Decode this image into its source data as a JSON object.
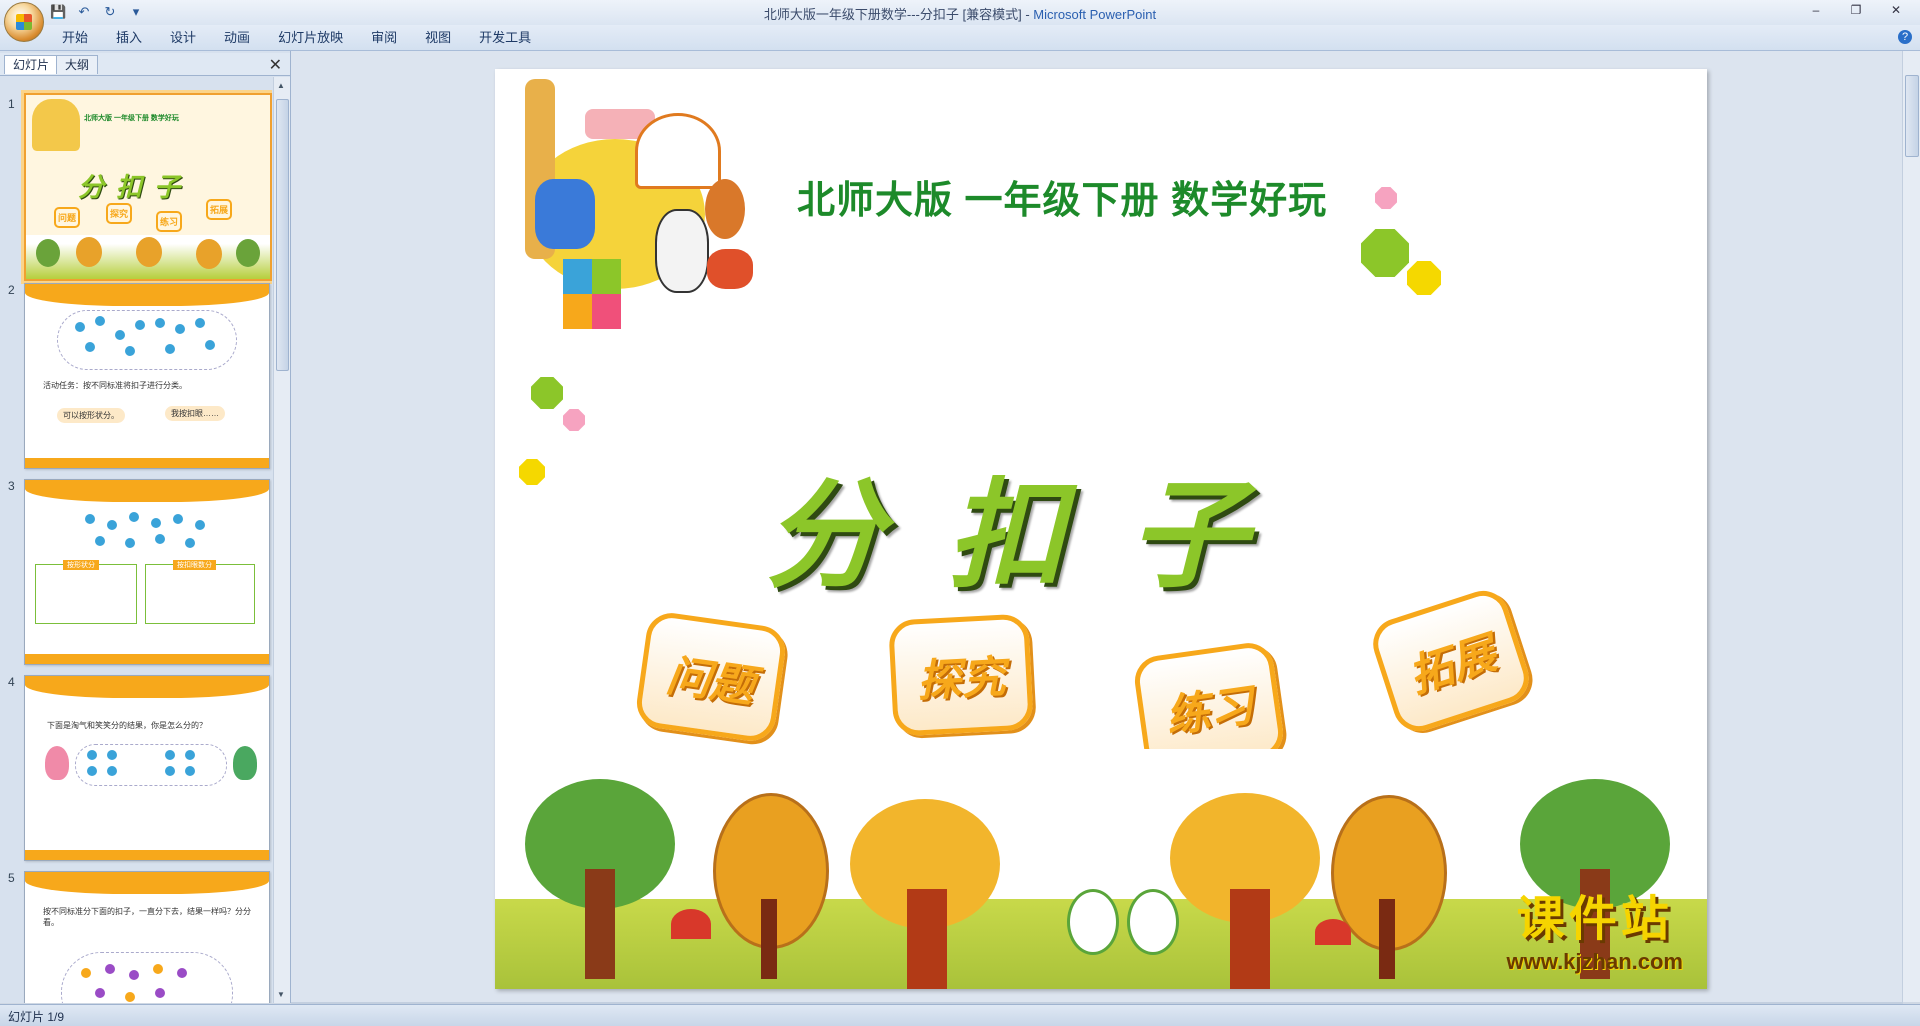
{
  "window": {
    "title": "北师大版一年级下册数学---分扣子 [兼容模式]",
    "app": "Microsoft PowerPoint",
    "separator": " - "
  },
  "qat": {
    "save": "💾",
    "undo": "↶",
    "redo": "↻",
    "more": "▾"
  },
  "ribbon_tabs": [
    "开始",
    "插入",
    "设计",
    "动画",
    "幻灯片放映",
    "审阅",
    "视图",
    "开发工具"
  ],
  "pane": {
    "tab_slides": "幻灯片",
    "tab_outline": "大纲",
    "close": "✕"
  },
  "thumbnails": [
    {
      "num": "1",
      "subtitle": "北师大版 一年级下册 数学好玩",
      "title": "分扣子",
      "btns": [
        "问题",
        "探究",
        "练习",
        "拓展"
      ]
    },
    {
      "num": "2",
      "task": "活动任务：按不同标准将扣子进行分类。",
      "bubble1": "可以按形状分。",
      "bubble2": "我按扣眼……"
    },
    {
      "num": "3",
      "label1": "按形状分",
      "label2": "按扣眼数分"
    },
    {
      "num": "4",
      "text": "下面是淘气和笑笑分的结果，你是怎么分的？"
    },
    {
      "num": "5",
      "text": "按不同标准分下面的扣子，一直分下去，结果一样吗？分分看。"
    }
  ],
  "slide": {
    "subtitle": "北师大版  一年级下册  数学好玩",
    "title": "分扣子",
    "buttons": [
      "问题",
      "探究",
      "练习",
      "拓展"
    ]
  },
  "watermark": {
    "line1": "课件站",
    "line2": "www.kjzhan.com"
  },
  "status": {
    "slide_counter": "幻灯片 1/9"
  },
  "colors": {
    "accent_orange": "#f7a81b",
    "title_green": "#8cc629",
    "subtitle_green": "#1d8a2a"
  }
}
